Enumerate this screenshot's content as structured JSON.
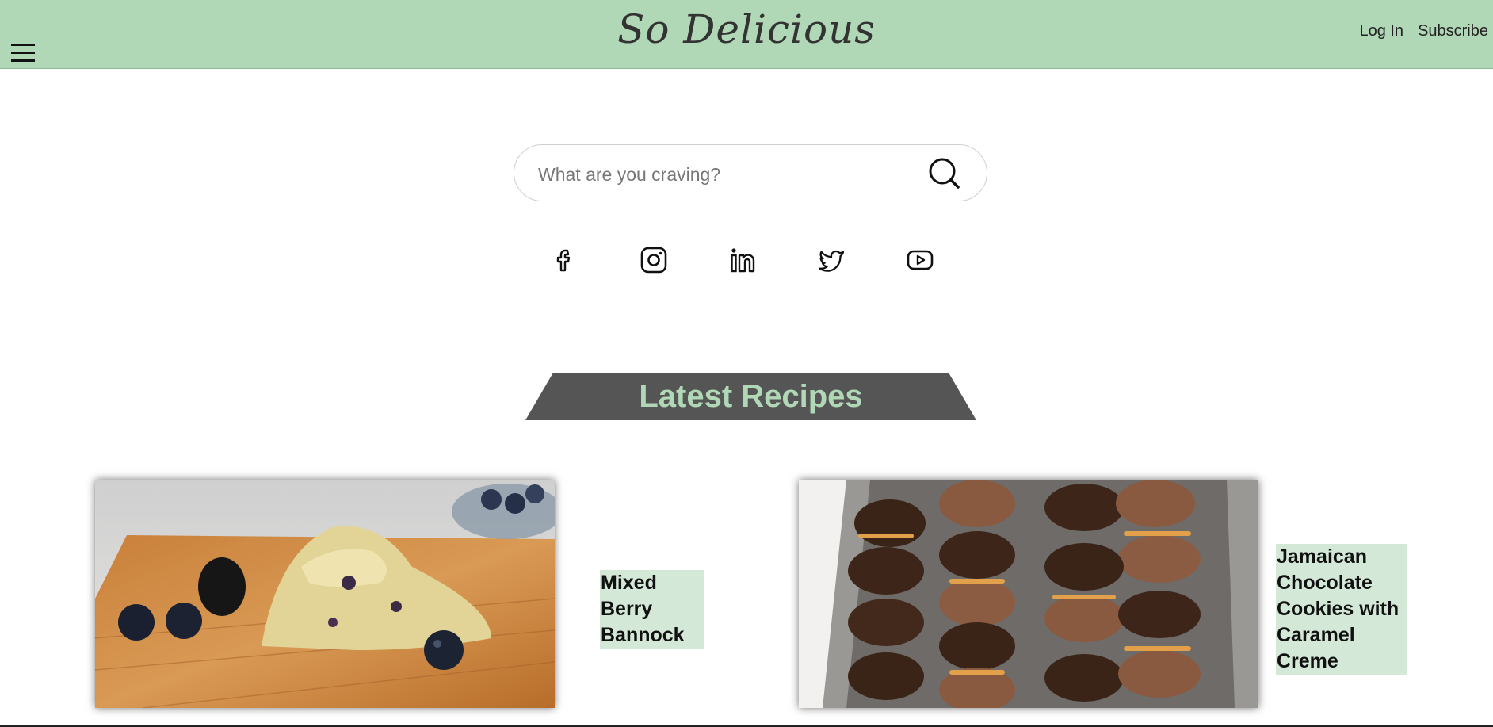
{
  "header": {
    "logo": "So Delicious",
    "nav": [
      "Log In",
      "Subscribe"
    ],
    "menu_icon": "hamburger-menu-icon",
    "background_color": "#b0d8b6"
  },
  "search": {
    "placeholder": "What are you craving?",
    "icon": "search-icon"
  },
  "social": [
    "facebook-icon",
    "instagram-icon",
    "linkedin-icon",
    "twitter-icon",
    "youtube-icon"
  ],
  "section": {
    "title": "Latest Recipes",
    "banner_color": "#555555",
    "title_color": "#b0d8b6"
  },
  "recipes": [
    {
      "title": "Mixed Berry Bannock",
      "image": "berry-bannock-photo"
    },
    {
      "title": "Jamaican Chocolate Cookies with Caramel Creme",
      "image": "chocolate-cookies-photo"
    }
  ]
}
